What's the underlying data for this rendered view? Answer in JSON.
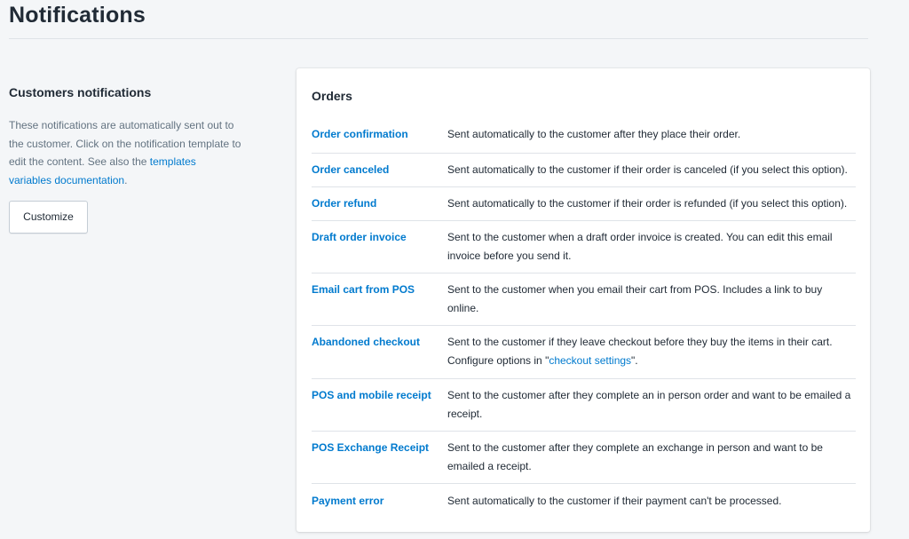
{
  "page": {
    "title": "Notifications"
  },
  "aside": {
    "heading": "Customers notifications",
    "desc_text": "These notifications are automatically sent out to the customer. Click on the notification template to edit the content. See also the ",
    "desc_link": "templates variables documentation",
    "desc_end": ".",
    "button_label": "Customize"
  },
  "card": {
    "heading": "Orders",
    "rows": [
      {
        "name": "Order confirmation",
        "desc": "Sent automatically to the customer after they place their order."
      },
      {
        "name": "Order canceled",
        "desc": "Sent automatically to the customer if their order is canceled (if you select this option)."
      },
      {
        "name": "Order refund",
        "desc": "Sent automatically to the customer if their order is refunded (if you select this option)."
      },
      {
        "name": "Draft order invoice",
        "desc": "Sent to the customer when a draft order invoice is created. You can edit this email invoice before you send it."
      },
      {
        "name": "Email cart from POS",
        "desc": "Sent to the customer when you email their cart from POS. Includes a link to buy online."
      },
      {
        "name": "Abandoned checkout",
        "desc_pre": "Sent to the customer if they leave checkout before they buy the items in their cart. Configure options in \"",
        "desc_link": "checkout settings",
        "desc_post": "\"."
      },
      {
        "name": "POS and mobile receipt",
        "desc": "Sent to the customer after they complete an in person order and want to be emailed a receipt."
      },
      {
        "name": "POS Exchange Receipt",
        "desc": "Sent to the customer after they complete an exchange in person and want to be emailed a receipt."
      },
      {
        "name": "Payment error",
        "desc": "Sent automatically to the customer if their payment can't be processed."
      }
    ]
  },
  "colors": {
    "link": "#007ace",
    "background": "#f4f6f8",
    "text": "#212b36",
    "muted": "#637381"
  }
}
